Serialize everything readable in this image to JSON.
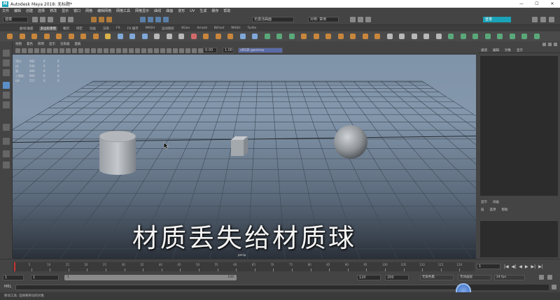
{
  "window": {
    "title": "Autodesk Maya 2018: 无标题*",
    "logo_glyph": "M",
    "controls": [
      "—",
      "☐",
      "✕"
    ]
  },
  "menubar": {
    "items": [
      "文件",
      "编辑",
      "创建",
      "选择",
      "修改",
      "显示",
      "窗口",
      "网格",
      "编辑网格",
      "网格工具",
      "网格显示",
      "曲线",
      "曲面",
      "变形",
      "UV",
      "生成",
      "缓存",
      "帮助"
    ]
  },
  "statusline": {
    "mode_dropdown": "建模",
    "symmetry_label": "对称: 禁用",
    "live_surface": "无激活曲面",
    "panel_toggle": "登录"
  },
  "shelf_tabs": {
    "items": [
      "曲线/曲面",
      "多边形建模",
      "雕刻",
      "绑定",
      "动画",
      "渲染",
      "FX",
      "FX 缓存",
      "MASH",
      "运动图形",
      "XGen",
      "Arnold",
      "Bifrost",
      "MASH",
      "Turtle"
    ],
    "active_index": 1
  },
  "viewport": {
    "menu": [
      "视图",
      "着色",
      "照明",
      "显示",
      "渲染器",
      "面板"
    ],
    "toolbar": {
      "field_a": "0.00",
      "field_b": "1.00",
      "color_space": "sRGB gamma"
    },
    "hud": [
      [
        "顶点:",
        "482",
        "0",
        "0"
      ],
      [
        "边:",
        "930",
        "0",
        "0"
      ],
      [
        "面:",
        "469",
        "0",
        "0"
      ],
      [
        "三角形:",
        "900",
        "0",
        "0"
      ],
      [
        "UV:",
        "557",
        "0",
        "0"
      ]
    ],
    "camera_label": "persp",
    "caption": "材质丢失给材质球"
  },
  "right_panel": {
    "tabs": [
      "通道",
      "编辑",
      "对象",
      "显示"
    ],
    "layer_tabs": [
      "显示",
      "动画"
    ],
    "layer_menu": [
      "层",
      "选项",
      "帮助"
    ]
  },
  "timeslider": {
    "ticks": [
      "5",
      "10",
      "15",
      "20",
      "25",
      "30",
      "35",
      "40",
      "45",
      "50",
      "55",
      "60",
      "65",
      "70",
      "75",
      "80",
      "85",
      "90",
      "95",
      "100",
      "105",
      "110",
      "115",
      "120"
    ],
    "current_frame": "1",
    "play_controls": [
      "|◀",
      "◀|",
      "◀",
      "▶",
      "▶|",
      "▶|"
    ]
  },
  "range": {
    "start": "1",
    "inner_start": "1",
    "bar_start": "1",
    "bar_end": "120",
    "inner_end": "120",
    "end": "200",
    "character_set": "无角色集",
    "anim_layer": "无动画层",
    "fps": "24 fps"
  },
  "command_line": {
    "label": "MEL",
    "value": ""
  },
  "help_line": {
    "text": "移动工具: 选择要移动的对象"
  }
}
